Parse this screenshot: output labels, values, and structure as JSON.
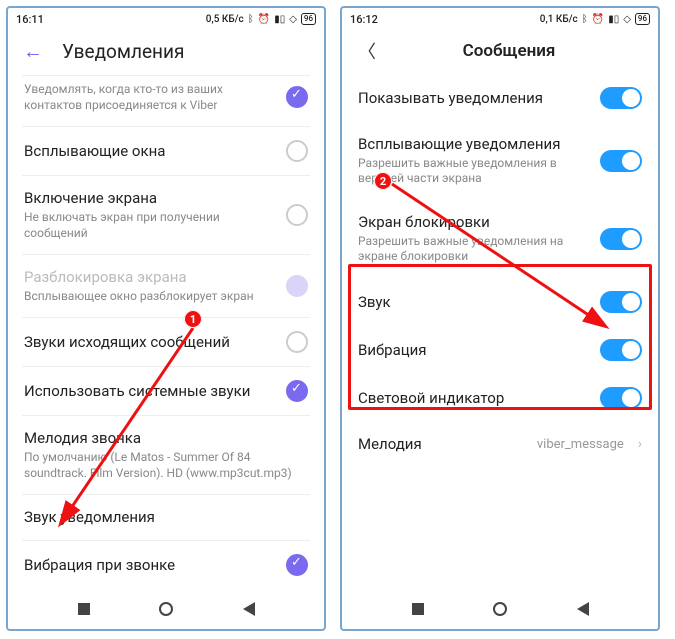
{
  "left": {
    "status": {
      "time": "16:11",
      "net": "0,5 КБ/с",
      "battery": "96"
    },
    "header": {
      "title": "Уведомления"
    },
    "rows": {
      "r0": {
        "label": "",
        "sub": "Уведомлять, когда кто-то из ваших контактов присоединяется к Viber"
      },
      "r1": {
        "label": "Всплывающие окна"
      },
      "r2": {
        "label": "Включение экрана",
        "sub": "Не включать экран при получении сообщений"
      },
      "r3": {
        "label": "Разблокировка экрана",
        "sub": "Всплывающее окно разблокирует экран"
      },
      "r4": {
        "label": "Звуки исходящих сообщений"
      },
      "r5": {
        "label": "Использовать системные звуки"
      },
      "r6": {
        "label": "Мелодия звонка",
        "sub": "По умолчанию (Le Matos - Summer Of 84 soundtrack. Film Version). HD (www.mp3cut.mp3)"
      },
      "r7": {
        "label": "Звук уведомления"
      },
      "r8": {
        "label": "Вибрация при звонке"
      }
    },
    "marker1": "1"
  },
  "right": {
    "status": {
      "time": "16:12",
      "net": "0,1 КБ/с",
      "battery": "96"
    },
    "header": {
      "title": "Сообщения"
    },
    "rows": {
      "r0": {
        "label": "Показывать уведомления"
      },
      "r1": {
        "label": "Всплывающие уведомления",
        "sub": "Разрешить важные уведомления в верхней части экрана"
      },
      "r2": {
        "label": "Экран блокировки",
        "sub": "Разрешить важные уведомления на экране блокировки"
      },
      "r3": {
        "label": "Звук"
      },
      "r4": {
        "label": "Вибрация"
      },
      "r5": {
        "label": "Световой индикатор"
      },
      "r6": {
        "label": "Мелодия",
        "value": "viber_message"
      }
    },
    "marker2": "2"
  }
}
